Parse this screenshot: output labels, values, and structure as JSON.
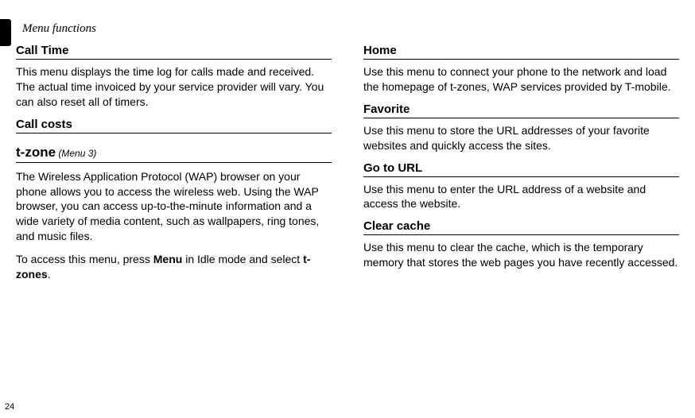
{
  "chapter": "Menu functions",
  "page_number": "24",
  "left": {
    "call_time": {
      "heading": "Call Time",
      "body": "This menu displays the time log for calls made and received. The actual time invoiced by your service provider will vary. You can also reset all of timers."
    },
    "call_costs": {
      "heading": "Call costs"
    },
    "tzone": {
      "heading": "t-zone",
      "menu_ref": " (Menu 3)",
      "body1": "The Wireless Application Protocol (WAP) browser on your phone allows you to access the wireless web. Using the WAP browser, you can access up-to-the-minute information and a wide variety of media content, such as wallpapers, ring tones, and music files.",
      "body2_a": "To access this menu, press ",
      "body2_menu": "Menu",
      "body2_b": " in Idle mode and select ",
      "body2_tzones": "t-zones",
      "body2_c": "."
    }
  },
  "right": {
    "home": {
      "heading": "Home",
      "body": "Use this menu to connect your phone to the network and load the homepage of t-zones, WAP services provided by T-mobile."
    },
    "favorite": {
      "heading": "Favorite",
      "body": "Use this menu to store the URL addresses of your favorite websites and quickly access the sites."
    },
    "gotourl": {
      "heading": "Go to URL",
      "body": "Use this menu to enter the URL address of a website and access the website."
    },
    "clearcache": {
      "heading": "Clear cache",
      "body": "Use this menu to clear the cache, which is the temporary memory that stores the web pages you have recently accessed."
    }
  }
}
